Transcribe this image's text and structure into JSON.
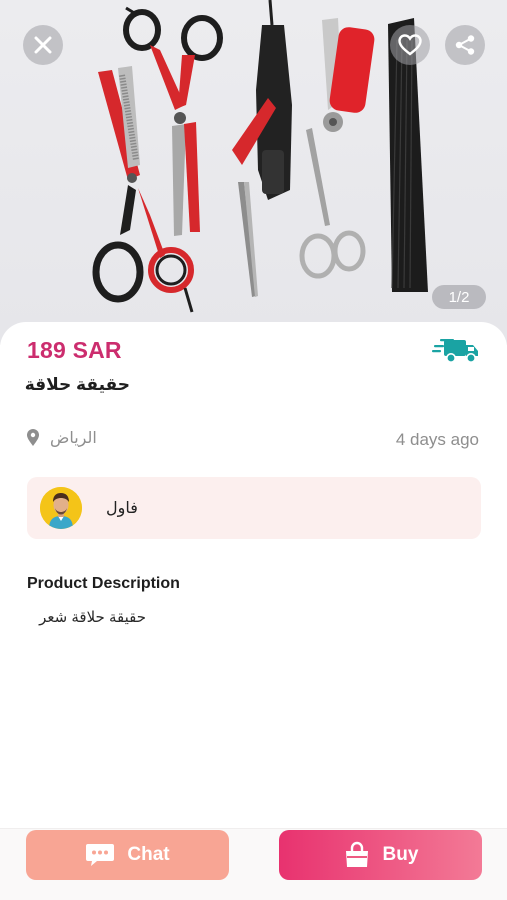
{
  "gallery": {
    "counter": "1/2",
    "close_icon": "close-icon",
    "favorite_icon": "heart-icon",
    "share_icon": "share-icon"
  },
  "product": {
    "price": "189 SAR",
    "title": "حقيقة حلاقة",
    "delivery_icon": "delivery-truck-icon",
    "location": "الرياض",
    "posted": "4 days ago"
  },
  "seller": {
    "name": "فاول"
  },
  "description": {
    "heading": "Product Description",
    "text": "حقيقة حلاقة شعر"
  },
  "actions": {
    "chat_label": "Chat",
    "buy_label": "Buy"
  },
  "colors": {
    "price": "#cc2d6e",
    "truck": "#1aa3a3",
    "chat_button": "#f8a594",
    "buy_button_start": "#e8326f",
    "buy_button_end": "#f37a96",
    "seller_card": "#fcefee"
  }
}
